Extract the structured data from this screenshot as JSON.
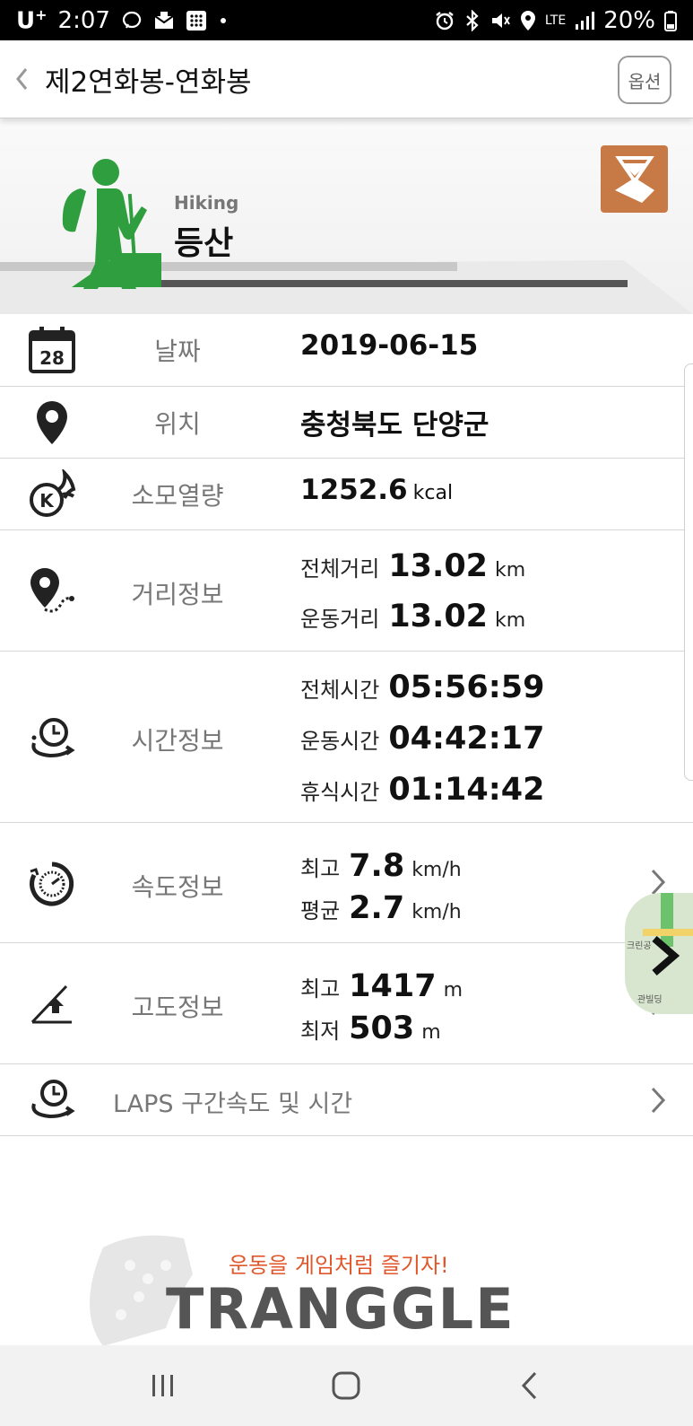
{
  "status_bar": {
    "carrier": "U",
    "carrier_sup": "+",
    "time": "2:07",
    "network": "LTE",
    "battery": "20%",
    "icons": [
      "chat-icon",
      "mail-icon",
      "grid-app-icon",
      "dot-icon",
      "alarm-icon",
      "bluetooth-icon",
      "mute-icon",
      "location-icon",
      "signal-icon",
      "battery-icon"
    ]
  },
  "header": {
    "title": "제2연화봉-연화봉",
    "options_label": "옵션",
    "back_icon": "chevron-left-icon"
  },
  "activity": {
    "name_en": "Hiking",
    "name_ko": "등산",
    "icon": "hiker-icon",
    "badge_icon": "map-badge-icon",
    "accent_color": "#2e9e3e"
  },
  "rows": {
    "date": {
      "label": "날짜",
      "value": "2019-06-15",
      "calendar_day": "28"
    },
    "location": {
      "label": "위치",
      "value": "충청북도 단양군"
    },
    "calories": {
      "label": "소모열량",
      "value": "1252.6",
      "unit": "kcal"
    },
    "distance": {
      "label": "거리정보",
      "total_label": "전체거리",
      "total_value": "13.02",
      "total_unit": "km",
      "moving_label": "운동거리",
      "moving_value": "13.02",
      "moving_unit": "km"
    },
    "time": {
      "label": "시간정보",
      "total_label": "전체시간",
      "total_value": "05:56:59",
      "moving_label": "운동시간",
      "moving_value": "04:42:17",
      "rest_label": "휴식시간",
      "rest_value": "01:14:42"
    },
    "speed": {
      "label": "속도정보",
      "max_label": "최고",
      "max_value": "7.8",
      "max_unit": "km/h",
      "avg_label": "평균",
      "avg_value": "2.7",
      "avg_unit": "km/h"
    },
    "altitude": {
      "label": "고도정보",
      "max_label": "최고",
      "max_value": "1417",
      "max_unit": "m",
      "min_label": "최저",
      "min_value": "503",
      "min_unit": "m"
    },
    "laps": {
      "label": "LAPS 구간속도 및 시간"
    }
  },
  "footer_ad": {
    "slogan": "운동을 게임처럼 즐기자!",
    "brand": "TRANGGLE"
  },
  "minimap": {
    "labels": [
      "크린공",
      "관빌딩"
    ]
  }
}
